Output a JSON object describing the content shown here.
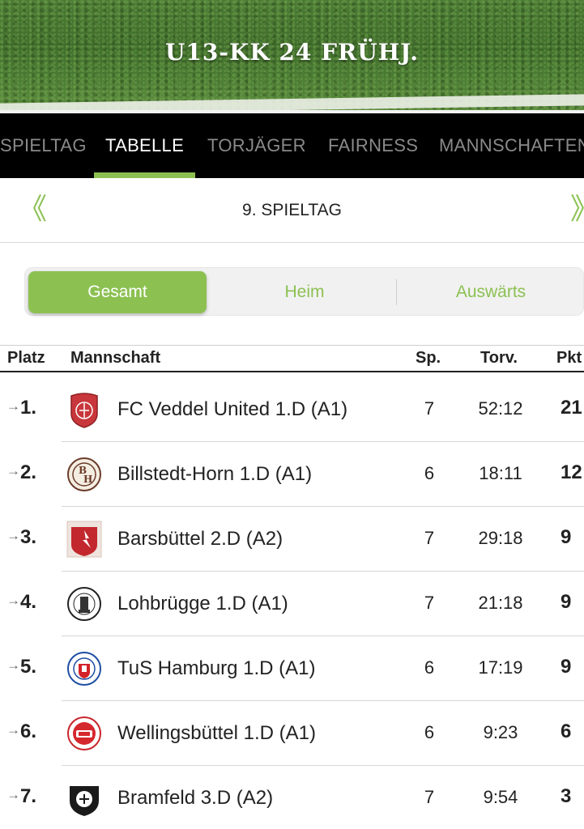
{
  "header": {
    "title": "U13-KK 24 FRÜHJ."
  },
  "tabs": [
    {
      "label": "SPIELTAG",
      "active": false
    },
    {
      "label": "TABELLE",
      "active": true
    },
    {
      "label": "TORJÄGER",
      "active": false
    },
    {
      "label": "FAIRNESS",
      "active": false
    },
    {
      "label": "MANNSCHAFTEN",
      "active": false
    }
  ],
  "round": {
    "prev_icon": "double-chevron-left-icon",
    "label": "9. SPIELTAG",
    "next_icon": "double-chevron-right-icon",
    "prev_glyph": "《",
    "next_glyph": "》"
  },
  "filter": {
    "options": [
      "Gesamt",
      "Heim",
      "Auswärts"
    ],
    "selected": "Gesamt"
  },
  "table": {
    "headers": {
      "platz": "Platz",
      "mannschaft": "Mannschaft",
      "sp": "Sp.",
      "torv": "Torv.",
      "pkt": "Pkt"
    },
    "rows": [
      {
        "trend": "→",
        "rank": "1.",
        "team": "FC Veddel United 1.D (A1)",
        "sp": "7",
        "torv": "52:12",
        "pkt": "21",
        "logo": "fc-veddel-logo-icon"
      },
      {
        "trend": "→",
        "rank": "2.",
        "team": "Billstedt-Horn 1.D (A1)",
        "sp": "6",
        "torv": "18:11",
        "pkt": "12",
        "logo": "billstedt-horn-logo-icon"
      },
      {
        "trend": "→",
        "rank": "3.",
        "team": "Barsbüttel 2.D (A2)",
        "sp": "7",
        "torv": "29:18",
        "pkt": "9",
        "logo": "barsbuettel-logo-icon"
      },
      {
        "trend": "→",
        "rank": "4.",
        "team": "Lohbrügge 1.D (A1)",
        "sp": "7",
        "torv": "21:18",
        "pkt": "9",
        "logo": "lohbruegge-logo-icon"
      },
      {
        "trend": "→",
        "rank": "5.",
        "team": "TuS Hamburg 1.D (A1)",
        "sp": "6",
        "torv": "17:19",
        "pkt": "9",
        "logo": "tus-hamburg-logo-icon"
      },
      {
        "trend": "→",
        "rank": "6.",
        "team": "Wellingsbüttel 1.D (A1)",
        "sp": "6",
        "torv": "9:23",
        "pkt": "6",
        "logo": "wellingsbuettel-logo-icon"
      },
      {
        "trend": "→",
        "rank": "7.",
        "team": "Bramfeld 3.D (A2)",
        "sp": "7",
        "torv": "9:54",
        "pkt": "3",
        "logo": "bramfeld-logo-icon"
      }
    ]
  },
  "colors": {
    "accent": "#8cc152",
    "tab_bar": "#000000",
    "banner_grass": "#4a7a33"
  }
}
